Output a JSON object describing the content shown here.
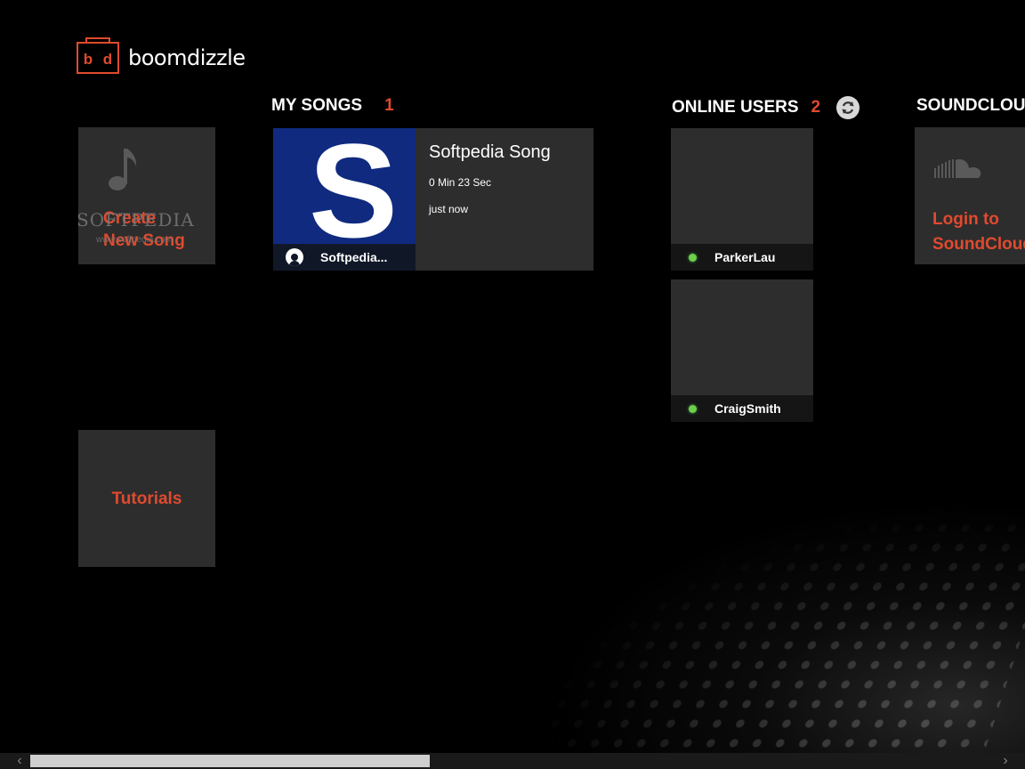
{
  "app": {
    "logo_letters_left": "b",
    "logo_letters_right": "d",
    "name": "boomdizzle"
  },
  "colors": {
    "accent": "#e04a2e",
    "tile_bg": "#2d2d2d",
    "online_status": "#6ecf4a"
  },
  "left_column": {
    "create_tile": {
      "icon": "music-note-icon",
      "label_line1": "Create",
      "label_line2": "New Song"
    },
    "tutorials_tile": {
      "label": "Tutorials"
    },
    "watermark": "SOFTPEDIA",
    "watermark_sub": "www.softpedia.com"
  },
  "my_songs": {
    "title": "MY SONGS",
    "count": "1",
    "songs": [
      {
        "art_letter": "S",
        "title": "Softpedia Song",
        "duration": "0 Min 23 Sec",
        "updated": "just now",
        "owner": "Softpedia..."
      }
    ]
  },
  "online_users": {
    "title": "ONLINE USERS",
    "count": "2",
    "refresh_icon": "refresh-icon",
    "users": [
      {
        "name": "ParkerLau",
        "status": "online"
      },
      {
        "name": "CraigSmith",
        "status": "online"
      }
    ]
  },
  "soundcloud": {
    "title": "SOUNDCLOUD",
    "icon": "soundcloud-icon",
    "login_line1": "Login to",
    "login_line2": "SoundCloud"
  }
}
